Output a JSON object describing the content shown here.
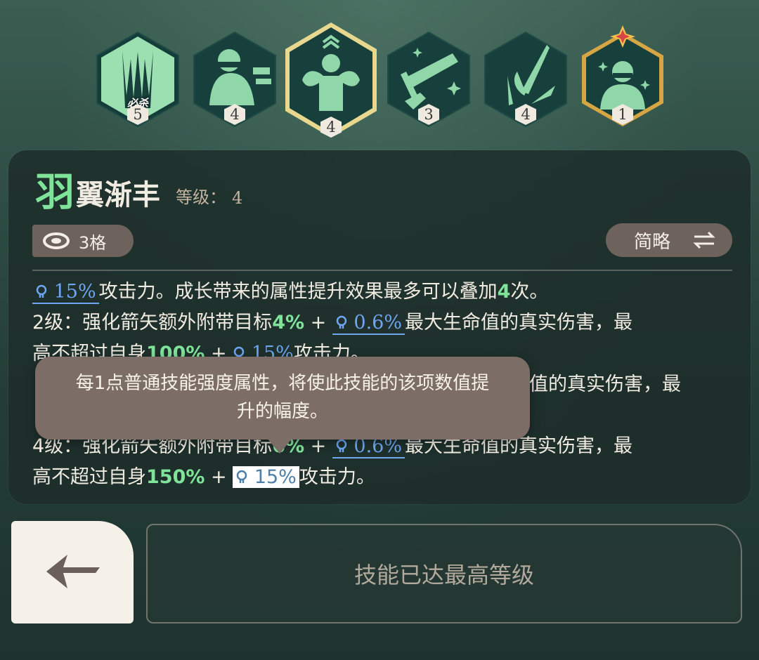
{
  "skills": [
    {
      "name": "必杀技能",
      "level": "5",
      "tag": "必杀",
      "icon": "claw-icon",
      "selected": false
    },
    {
      "name": "战士技能",
      "level": "4",
      "tag": "",
      "icon": "knight-icon",
      "selected": false
    },
    {
      "name": "力量技能",
      "level": "4",
      "tag": "",
      "icon": "strongman-icon",
      "selected": true
    },
    {
      "name": "剑技能",
      "level": "3",
      "tag": "",
      "icon": "sword-icon",
      "selected": false
    },
    {
      "name": "箭技能",
      "level": "4",
      "tag": "",
      "icon": "arrow-burst-icon",
      "selected": false
    },
    {
      "name": "精英技能",
      "level": "1",
      "tag": "",
      "icon": "star-knight-icon",
      "selected": false
    }
  ],
  "skill_title": {
    "first_char": "羽",
    "rest": "翼渐丰"
  },
  "level_label": "等级：",
  "level_value": "4",
  "slot_text": "3格",
  "mode_button": "简略",
  "description": {
    "l1": {
      "val": "15%",
      "text": "攻击力。成长带来的属性提升效果最多可以叠加",
      "num": "4",
      "end": "次。"
    },
    "l2": {
      "prefix": "2级：强化箭矢额外附带目标",
      "pct": "4%",
      "plus": " + ",
      "val": "0.6%",
      "text": "最大生命值的真实伤害，最"
    },
    "l3": {
      "prefix": "高不超过自身",
      "pct": "100%",
      "plus": " + ",
      "val": "15%",
      "text": "攻击力。"
    },
    "l4": {
      "text": "命值的真实伤害，最"
    },
    "l6": {
      "prefix": "4级：强化箭矢额外附带目标",
      "pct": "6%",
      "plus": " + ",
      "val": "0.6%",
      "text": "最大生命值的真实伤害，最"
    },
    "l7": {
      "prefix": "高不超过自身",
      "pct": "150%",
      "plus": " + ",
      "val": "15%",
      "text": "攻击力。"
    }
  },
  "tooltip": {
    "line1": "每1点普通技能强度属性，将使此技能的该项数值提",
    "line2": "升的幅度。"
  },
  "max_level_text": "技能已达最高等级",
  "colors": {
    "green": "#7fe39a",
    "blue": "#6ea6f2",
    "gold": "#f0d47a"
  }
}
